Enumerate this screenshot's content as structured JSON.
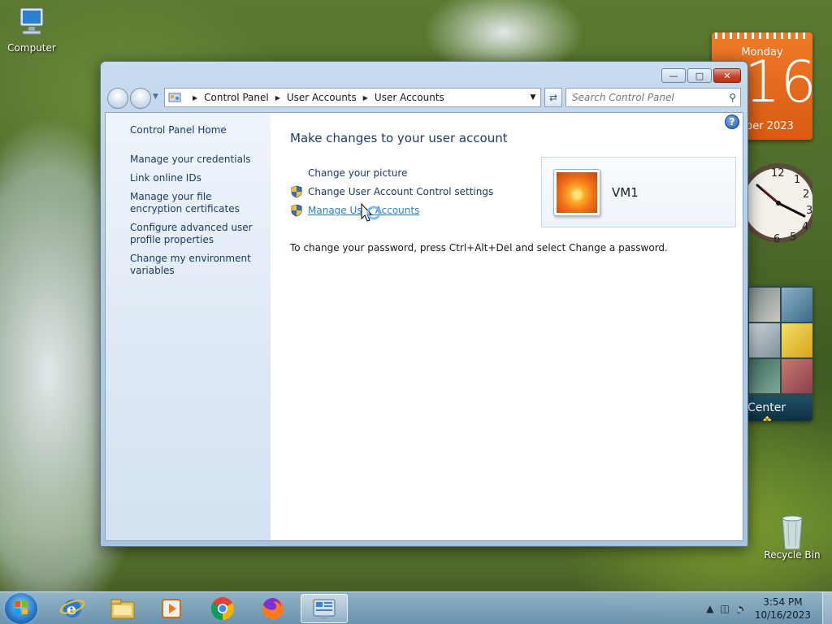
{
  "desktop": {
    "icons": [
      {
        "label": "Computer"
      },
      {
        "label": "Recycle Bin"
      }
    ]
  },
  "gadgets": {
    "calendar": {
      "weekday": "Monday",
      "day": "16",
      "month_partial": "ober 2023"
    },
    "clock": {
      "visible_numbers": [
        "12",
        "1",
        "2",
        "3",
        "4",
        "5",
        "6"
      ]
    },
    "media": {
      "label": "Center"
    }
  },
  "window": {
    "address": {
      "segments": [
        "Control Panel",
        "User Accounts",
        "User Accounts"
      ]
    },
    "search": {
      "placeholder": "Search Control Panel"
    },
    "left_pane": {
      "home": "Control Panel Home",
      "tasks": [
        "Manage your credentials",
        "Link online IDs",
        "Manage your file encryption certificates",
        "Configure advanced user profile properties",
        "Change my environment variables"
      ]
    },
    "main": {
      "title": "Make changes to your user account",
      "links": [
        {
          "label": "Change your picture",
          "shield": false
        },
        {
          "label": "Change User Account Control settings",
          "shield": true
        },
        {
          "label": "Manage User Accounts",
          "shield": true,
          "hover": true
        }
      ],
      "password_hint": "To change your password, press Ctrl+Alt+Del and select Change a password.",
      "user": {
        "name": "VM1"
      }
    }
  },
  "taskbar": {
    "pinned": [
      "internet-explorer-icon",
      "windows-explorer-icon",
      "media-player-icon",
      "chrome-icon",
      "firefox-icon",
      "control-panel-icon"
    ],
    "clock": {
      "time": "3:54 PM",
      "date": "10/16/2023"
    }
  }
}
